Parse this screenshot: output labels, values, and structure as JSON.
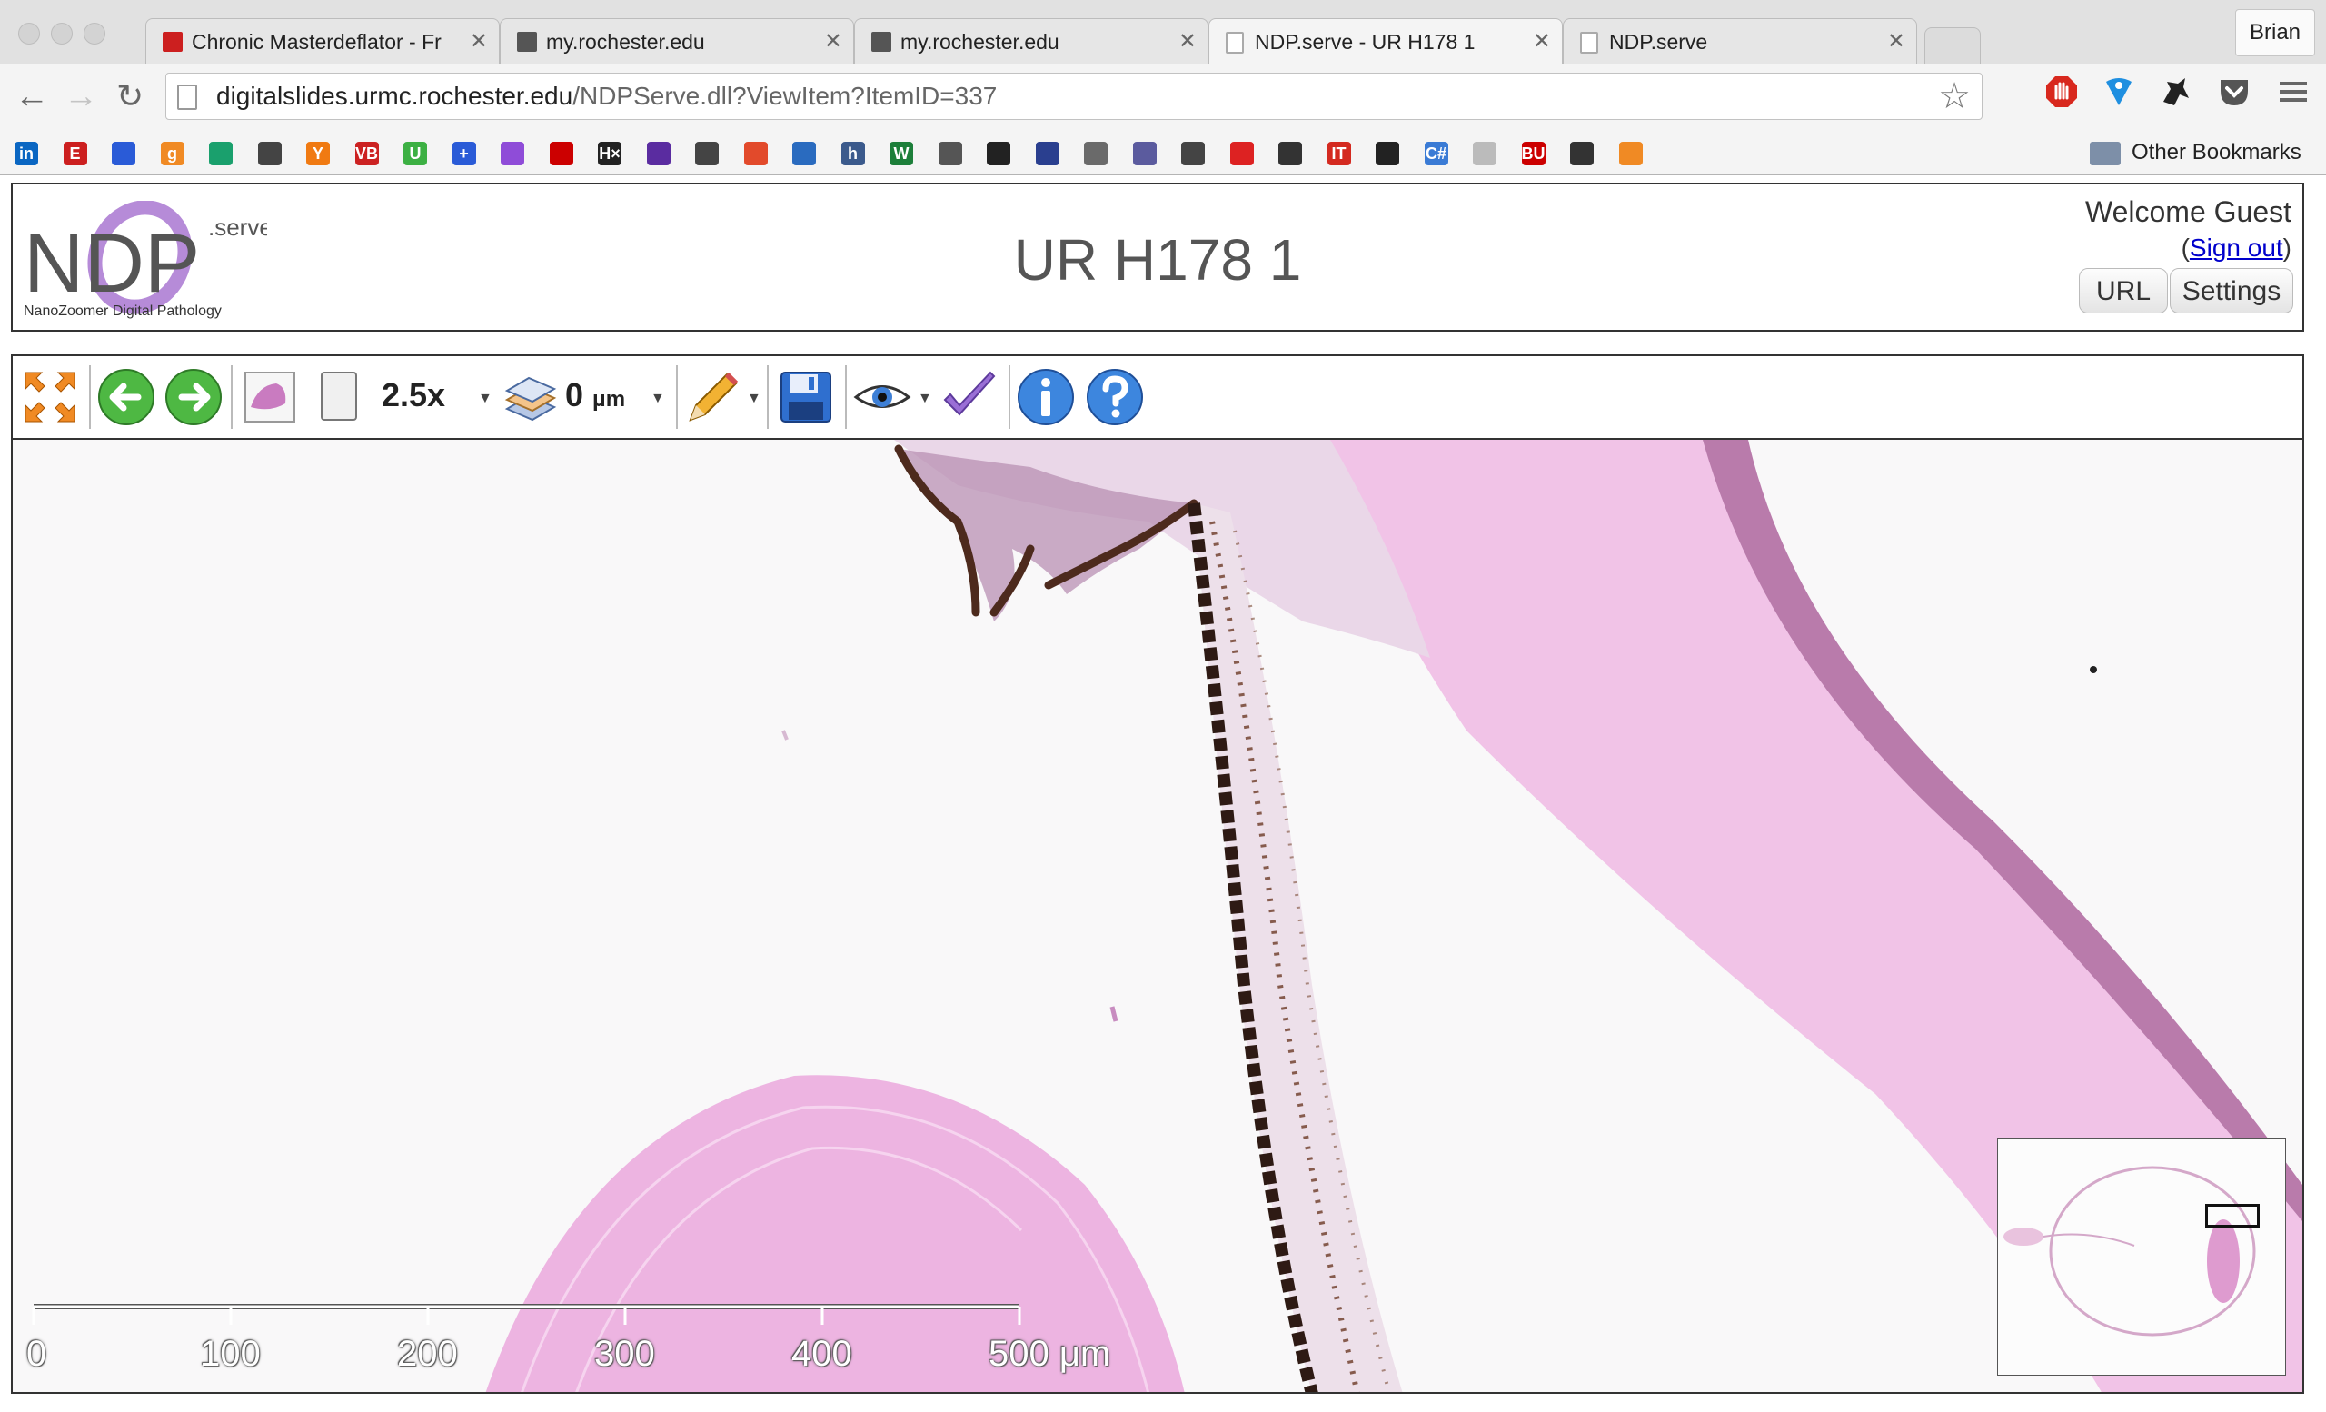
{
  "browser": {
    "tabs": [
      {
        "title": "Chronic Masterdeflator - Fr",
        "favicon": "espn-icon",
        "active": false
      },
      {
        "title": "my.rochester.edu",
        "favicon": "blackboard-icon",
        "active": false
      },
      {
        "title": "my.rochester.edu",
        "favicon": "blackboard-icon",
        "active": false
      },
      {
        "title": "NDP.serve - UR H178 1",
        "favicon": "page-icon",
        "active": true
      },
      {
        "title": "NDP.serve",
        "favicon": "page-icon",
        "active": false
      }
    ],
    "profile": "Brian",
    "url_host": "digitalslides.urmc.rochester.edu",
    "url_path": "/NDPServe.dll?ViewItem?ItemID=337",
    "other_bookmarks": "Other Bookmarks",
    "bookmark_glyphs": [
      "in",
      "E",
      "",
      "g",
      "",
      "",
      "Y",
      "VB",
      "U",
      "+",
      "",
      "",
      "H×",
      "",
      "",
      "",
      "",
      "h",
      "W",
      "",
      "",
      "",
      "",
      "",
      "",
      "",
      "",
      "IT",
      "",
      "C#",
      "",
      "BU",
      "",
      ""
    ],
    "colors": {
      "accent_red": "#d42a20"
    }
  },
  "ndp": {
    "logo_text": "NDP",
    "logo_serve": ".serve",
    "logo_subtitle": "NanoZoomer Digital Pathology",
    "title": "UR H178 1",
    "welcome": "Welcome Guest",
    "signout_open": "(",
    "signout": "Sign out",
    "signout_close": ")",
    "url_button": "URL",
    "settings_button": "Settings"
  },
  "viewer": {
    "zoom": "2.5x",
    "z_value": "0",
    "z_unit": "μm",
    "scale_labels": [
      "0",
      "100",
      "200",
      "300",
      "400",
      "500 μm"
    ]
  }
}
